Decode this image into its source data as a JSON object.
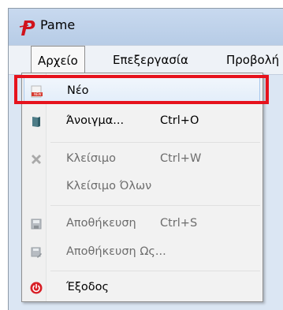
{
  "window": {
    "title": "Pame"
  },
  "menubar": {
    "items": [
      {
        "label": "Αρχείο",
        "active": true
      },
      {
        "label": "Επεξεργασία",
        "active": false
      },
      {
        "label": "Προβολή",
        "active": false
      }
    ]
  },
  "file_menu": {
    "items": [
      {
        "label": "Νέο",
        "shortcut": "",
        "icon": "new-file-icon",
        "enabled": true,
        "highlighted": true
      },
      {
        "label": "Άνοιγμα...",
        "shortcut": "Ctrl+O",
        "icon": "open-book-icon",
        "enabled": true,
        "highlighted": false
      },
      {
        "label": "Κλείσιμο",
        "shortcut": "Ctrl+W",
        "icon": "close-x-icon",
        "enabled": false,
        "highlighted": false
      },
      {
        "label": "Κλείσιμο Όλων",
        "shortcut": "",
        "icon": "",
        "enabled": false,
        "highlighted": false
      },
      {
        "label": "Αποθήκευση",
        "shortcut": "Ctrl+S",
        "icon": "save-icon",
        "enabled": false,
        "highlighted": false
      },
      {
        "label": "Αποθήκευση Ως...",
        "shortcut": "",
        "icon": "save-as-icon",
        "enabled": false,
        "highlighted": false
      },
      {
        "label": "Έξοδος",
        "shortcut": "",
        "icon": "exit-power-icon",
        "enabled": true,
        "highlighted": false
      }
    ]
  },
  "colors": {
    "highlight_border": "#e6121c",
    "app_logo": "#d0121c",
    "disabled_text": "#6d6d6d"
  }
}
